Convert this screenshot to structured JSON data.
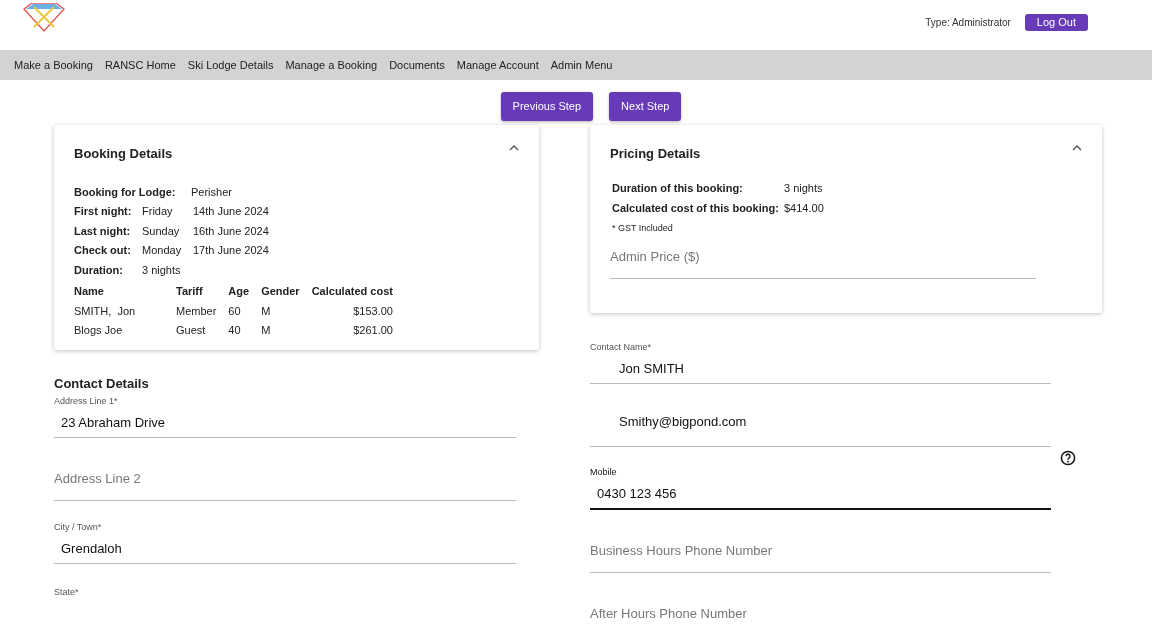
{
  "header": {
    "user_type": "Type: Administrator",
    "logout": "Log Out"
  },
  "nav": [
    "Make a Booking",
    "RANSC Home",
    "Ski Lodge Details",
    "Manage a Booking",
    "Documents",
    "Manage Account",
    "Admin Menu"
  ],
  "steps": [
    "Previous Step",
    "Next Step"
  ],
  "booking_details": {
    "title": "Booking Details",
    "expanded": true,
    "rows": [
      {
        "label": "Booking for Lodge:",
        "values": [
          "Perisher"
        ]
      },
      {
        "label": "First night:",
        "values": [
          "Friday",
          "14th June 2024"
        ]
      },
      {
        "label": "Last night:",
        "values": [
          "Sunday",
          "16th June 2024"
        ]
      },
      {
        "label": "Check out:",
        "values": [
          "Monday",
          "17th June 2024"
        ]
      },
      {
        "label": "Duration:",
        "values": [
          "3 nights"
        ]
      }
    ],
    "table": {
      "columns": [
        "Name",
        "Tariff",
        "Age",
        "Gender",
        "Calculated cost"
      ],
      "rows": [
        [
          "SMITH,  Jon",
          "Member",
          "60",
          "M",
          "$153.00"
        ],
        [
          "Blogs Joe",
          "Guest",
          "40",
          "M",
          "$261.00"
        ]
      ]
    }
  },
  "pricing_details": {
    "title": "Pricing Details",
    "expanded": true,
    "rows": [
      {
        "label": "Duration of this booking:",
        "value": "3 nights"
      },
      {
        "label": "Calculated cost of this booking:",
        "value": "$414.00"
      }
    ],
    "note": "* GST Included",
    "admin_price": {
      "placeholder": "Admin Price ($)"
    }
  },
  "contact_details": {
    "title": "Contact Details",
    "left_fields": [
      {
        "label": "Address Line 1*",
        "value": "23 Abraham Drive",
        "focused": false
      },
      {
        "placeholder": "Address Line 2",
        "focused": false
      },
      {
        "label": "City / Town*",
        "value": "Grendaloh",
        "focused": false
      },
      {
        "label": "State*",
        "focused": false
      }
    ],
    "right_fields": [
      {
        "label": "Contact Name*",
        "value": "Jon  SMITH",
        "focused": false
      },
      {
        "value": "Smithy@bigpond.com",
        "focused": false,
        "help": true
      },
      {
        "label": "Mobile",
        "value": "0430 123 456",
        "focused": true
      },
      {
        "placeholder": "Business Hours Phone Number",
        "focused": false
      },
      {
        "placeholder": "After Hours Phone Number",
        "focused": false
      }
    ]
  }
}
